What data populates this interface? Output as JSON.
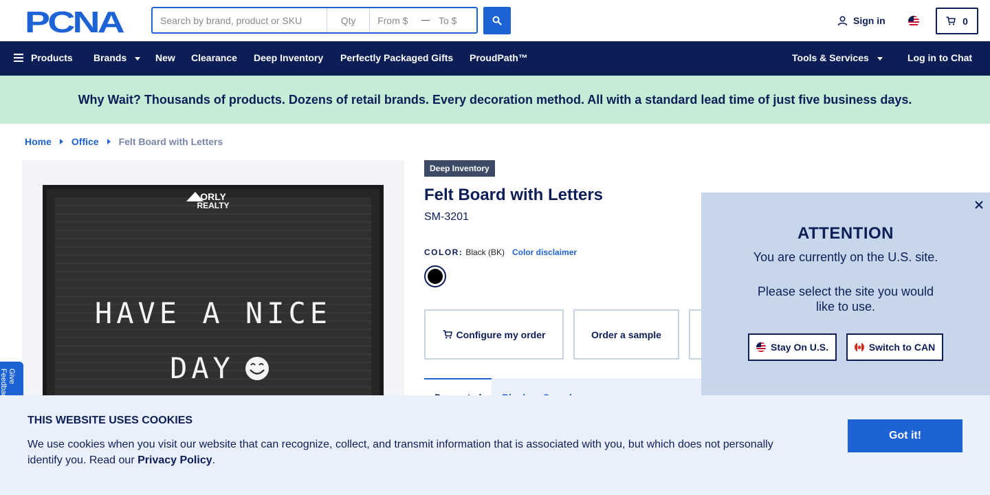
{
  "header": {
    "logo_text": "PCNA",
    "search_placeholder": "Search by brand, product or SKU",
    "qty_placeholder": "Qty",
    "from_placeholder": "From $",
    "to_placeholder": "To $",
    "sign_in": "Sign in",
    "cart_count": "0"
  },
  "nav": {
    "products": "Products",
    "brands": "Brands",
    "new": "New",
    "clearance": "Clearance",
    "deep_inventory": "Deep Inventory",
    "gifts": "Perfectly Packaged Gifts",
    "proudpath": "ProudPath™",
    "tools": "Tools & Services",
    "chat": "Log in to Chat"
  },
  "promo": {
    "text": "Why Wait? Thousands of products. Dozens of retail brands. Every decoration method. All with a standard lead time of just five business days."
  },
  "breadcrumb": {
    "home": "Home",
    "office": "Office",
    "current": "Felt Board with Letters"
  },
  "product": {
    "badge": "Deep Inventory",
    "title": "Felt Board with Letters",
    "sku": "SM-3201",
    "color_label": "COLOR:",
    "color_value": "Black (BK)",
    "color_disclaimer": "Color disclaimer",
    "swatch_color": "#000000",
    "image": {
      "brand_line1": "ORLY",
      "brand_line2": "REALTY",
      "line1": "HAVE A NICE",
      "line2": "DAY"
    }
  },
  "actions": {
    "configure": "Configure my order",
    "sample": "Order a sample"
  },
  "tabs": {
    "first": "Decorated",
    "second": "Blank or Samples"
  },
  "feedback": {
    "label": "Give Feedback"
  },
  "attention": {
    "title": "ATTENTION",
    "message1": "You are currently on the U.S. site.",
    "message2": "Please select the site you would like to use.",
    "stay": "Stay On U.S.",
    "switch": "Switch to CAN"
  },
  "cookie": {
    "title": "THIS WEBSITE USES COOKIES",
    "text": "We use cookies when you visit our website that can recognize, collect, and transmit information that is associated with you, but which does not personally identify you. Read our ",
    "link": "Privacy Policy",
    "end": ".",
    "button": "Got it!"
  },
  "colors": {
    "navy": "#0d1e57",
    "blue": "#1d63d6",
    "promo_bg": "#c4ecd7",
    "modal_bg": "#c8d6ec",
    "cookie_bg": "#eaf0fb"
  }
}
